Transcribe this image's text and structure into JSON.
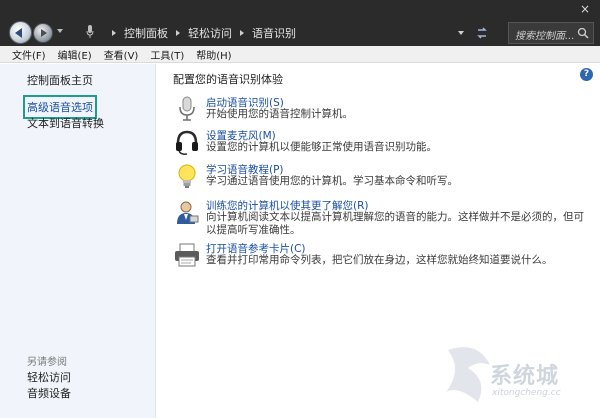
{
  "window": {
    "close_label": "×"
  },
  "address": {
    "crumbs": [
      "控制面板",
      "轻松访问",
      "语音识别"
    ]
  },
  "search": {
    "placeholder": "搜索控制面..."
  },
  "menu": {
    "items": [
      "文件(F)",
      "编辑(E)",
      "查看(V)",
      "工具(T)",
      "帮助(H)"
    ]
  },
  "sidebar": {
    "home": "控制面板主页",
    "links": [
      "高级语音选项",
      "文本到语音转换"
    ],
    "see_also": "另请参阅",
    "see_links": [
      "轻松访问",
      "音频设备"
    ]
  },
  "main": {
    "help_label": "?",
    "title": "配置您的语音识别体验",
    "tasks": [
      {
        "icon": "microphone-icon",
        "link": "启动语音识别(S)",
        "desc": "开始使用您的语音控制计算机。"
      },
      {
        "icon": "headset-icon",
        "link": "设置麦克风(M)",
        "desc": "设置您的计算机以便能够正常使用语音识别功能。"
      },
      {
        "icon": "lightbulb-icon",
        "link": "学习语音教程(P)",
        "desc": "学习通过语音使用您的计算机。学习基本命令和听写。"
      },
      {
        "icon": "user-speech-icon",
        "link": "训练您的计算机以使其更了解您(R)",
        "desc": "向计算机阅读文本以提高计算机理解您的语音的能力。这样做并不是必须的，但可以提高听写准确性。"
      },
      {
        "icon": "printer-icon",
        "link": "打开语音参考卡片(C)",
        "desc": "查看并打印常用命令列表，把它们放在身边，这样您就始终知道要说什么。"
      }
    ]
  },
  "watermark": {
    "text": "系统城",
    "sub": "xitongcheng.cc"
  }
}
